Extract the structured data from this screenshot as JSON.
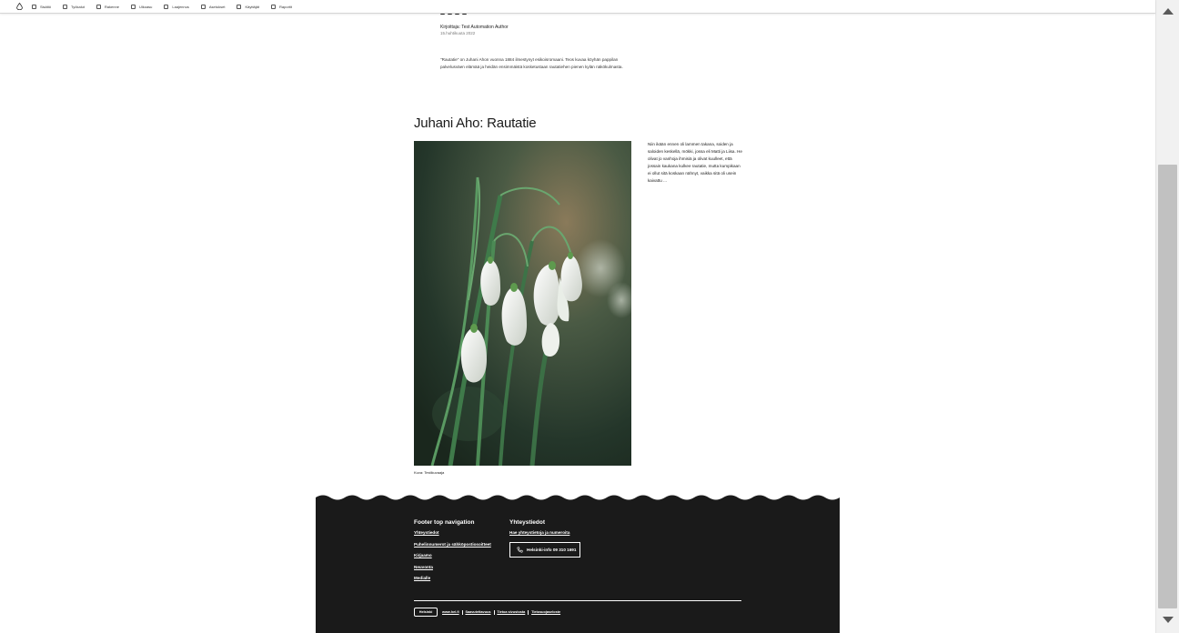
{
  "toolbar": {
    "items": [
      {
        "label": "Sisältö",
        "icon": "content-icon"
      },
      {
        "label": "Työkalut",
        "icon": "tools-icon"
      },
      {
        "label": "Rakenne",
        "icon": "structure-icon"
      },
      {
        "label": "Ulkoasu",
        "icon": "appearance-icon"
      },
      {
        "label": "Laajennus",
        "icon": "extend-icon"
      },
      {
        "label": "Asetukset",
        "icon": "config-icon"
      },
      {
        "label": "Käyttäjät",
        "icon": "people-icon"
      },
      {
        "label": "Raportit",
        "icon": "reports-icon"
      }
    ]
  },
  "article_top": {
    "author": "Kirjoittaja: Test Automation Author",
    "date": "15.huhtikuuta 2022",
    "lead": "\"Rautatie\" on Juhani Ahon vuonna 1884 ilmestynyt esikoisromaani. Teos kuvaa köyhän pappilan palvelusväen elämää ja heidän ensimmäistä kosketustaan rautatiehen pienen kylän näkökulmasta."
  },
  "section": {
    "heading": "Juhani Aho: Rautatie",
    "photo_caption": "Kuva: Testikuvaaja",
    "body": "Niin ikään ennen oli lammen takana, soiden ja saloiden keskellä, mökki, jossa eli Matti ja Liisa. He olivat jo vanhoja ihmisiä ja olivat kuulleet, että jossain kaukana kulkee rautatie, mutta kumpikaan ei ollut sitä koskaan nähnyt, vaikka sitä oli usein kaivattu ..."
  },
  "footer": {
    "nav_title": "Footer top navigation",
    "nav_links": [
      "Yhteystiedot",
      "Puhelinnumerot ja sähköpostiosoitteet",
      "Kirjaamo",
      "Neuvonta",
      "Medialle"
    ],
    "contact_title": "Yhteystiedot",
    "contact_link": "Hae yhteystietoja ja numeroita",
    "phone_label": "Helsinki-info 09 310 1691",
    "logo_text": "Helsinki",
    "bottom_links": [
      "www.hel.fi",
      "Saavutettavuus",
      "Tietoa sivustosta",
      "Tietosuojaseloste"
    ]
  }
}
